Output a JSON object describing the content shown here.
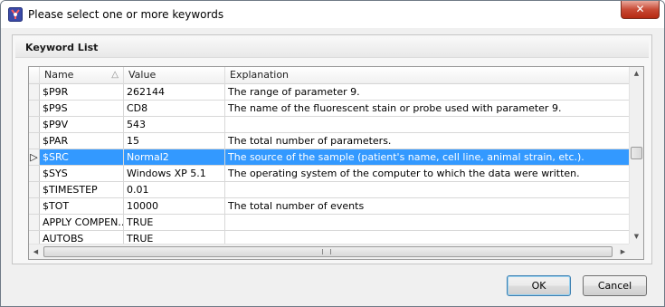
{
  "window": {
    "title": "Please select one or more keywords",
    "close_glyph": "✕",
    "app_icon": "flowjo-app-icon"
  },
  "group": {
    "title": "Keyword List"
  },
  "grid": {
    "columns": [
      "Name",
      "Value",
      "Explanation"
    ],
    "sort_indicator": "△",
    "selected_indicator": "▷",
    "rows": [
      {
        "name": "$P9R",
        "value": "262144",
        "explanation": "The range of parameter 9."
      },
      {
        "name": "$P9S",
        "value": "CD8",
        "explanation": "The name of the fluorescent stain or probe used with parameter 9."
      },
      {
        "name": "$P9V",
        "value": "543",
        "explanation": ""
      },
      {
        "name": "$PAR",
        "value": "15",
        "explanation": "The total number of parameters."
      },
      {
        "name": "$SRC",
        "value": "Normal2",
        "explanation": "The source of the sample (patient's name, cell line, animal strain, etc.)."
      },
      {
        "name": "$SYS",
        "value": "Windows XP 5.1",
        "explanation": "The operating system of the computer to which the data were written."
      },
      {
        "name": "$TIMESTEP",
        "value": "0.01",
        "explanation": ""
      },
      {
        "name": "$TOT",
        "value": "10000",
        "explanation": "The total number of events"
      },
      {
        "name": "APPLY COMPEN...",
        "value": "TRUE",
        "explanation": ""
      },
      {
        "name": "AUTOBS",
        "value": "TRUE",
        "explanation": ""
      }
    ],
    "selected_index": 4
  },
  "buttons": {
    "ok": "OK",
    "cancel": "Cancel"
  },
  "colors": {
    "selection": "#3399ff",
    "close_button": "#c84a35"
  }
}
